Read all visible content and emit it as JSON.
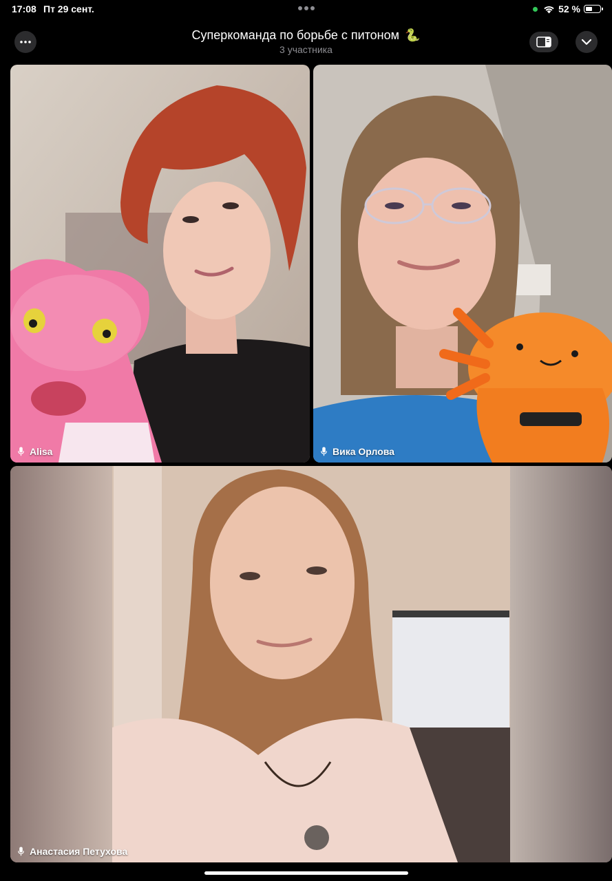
{
  "status_bar": {
    "time": "17:08",
    "date": "Пт 29 сент.",
    "battery_percent_text": "52 %",
    "battery_level": 0.52,
    "camera_indicator_color": "#33c759"
  },
  "header": {
    "title": "Суперкоманда по борьбе с питоном",
    "title_emoji": "🐍",
    "subtitle": "3 участника",
    "more_icon": "ellipsis-icon",
    "layout_icon": "sidebar-layout-icon",
    "collapse_icon": "chevron-down-icon"
  },
  "participants": [
    {
      "name": "Alisa",
      "mic_icon": "microphone-icon"
    },
    {
      "name": "Вика Орлова",
      "mic_icon": "microphone-icon"
    },
    {
      "name": "Анастасия Петухова",
      "mic_icon": "microphone-icon"
    }
  ],
  "colors": {
    "background": "#000000",
    "button_background": "#2c2c2e",
    "secondary_text": "#8e8e93"
  }
}
